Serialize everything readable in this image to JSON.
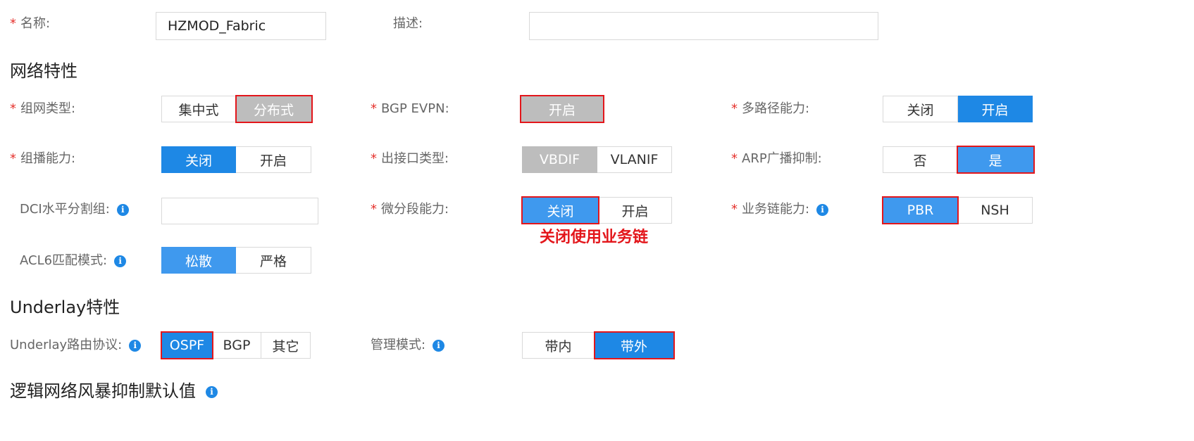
{
  "basic": {
    "required_mark": "*",
    "name_label": "名称:",
    "name_value": "HZMOD_Fabric",
    "desc_label": "描述:",
    "desc_value": ""
  },
  "network_section": {
    "title": "网络特性",
    "networking_type": {
      "label": "组网类型:",
      "options": [
        "集中式",
        "分布式"
      ],
      "selected": "分布式"
    },
    "bgp_evpn": {
      "label": "BGP EVPN:",
      "option": "开启"
    },
    "multipath": {
      "label": "多路径能力:",
      "options": [
        "关闭",
        "开启"
      ],
      "selected": "开启"
    },
    "multicast": {
      "label": "组播能力:",
      "options": [
        "关闭",
        "开启"
      ],
      "selected": "关闭"
    },
    "egress_type": {
      "label": "出接口类型:",
      "options": [
        "VBDIF",
        "VLANIF"
      ],
      "selected": "VBDIF"
    },
    "arp_suppress": {
      "label": "ARP广播抑制:",
      "options": [
        "否",
        "是"
      ],
      "selected": "是"
    },
    "dci_split": {
      "label": "DCI水平分割组:",
      "value": ""
    },
    "micro_seg": {
      "label": "微分段能力:",
      "options": [
        "关闭",
        "开启"
      ],
      "selected": "关闭",
      "note": "关闭使用业务链"
    },
    "service_chain": {
      "label": "业务链能力:",
      "options": [
        "PBR",
        "NSH"
      ],
      "selected": "PBR"
    },
    "acl6_mode": {
      "label": "ACL6匹配模式:",
      "options": [
        "松散",
        "严格"
      ],
      "selected": "松散"
    }
  },
  "underlay_section": {
    "title": "Underlay特性",
    "routing_protocol": {
      "label": "Underlay路由协议:",
      "options": [
        "OSPF",
        "BGP",
        "其它"
      ],
      "selected": "OSPF"
    },
    "mgmt_mode": {
      "label": "管理模式:",
      "options": [
        "带内",
        "带外"
      ],
      "selected": "带外"
    }
  },
  "storm_section": {
    "title": "逻辑网络风暴抑制默认值"
  },
  "icons": {
    "info": "info-icon",
    "required": "required-asterisk"
  },
  "colors": {
    "selected_blue": "#1e88e5",
    "light_blue": "#3f99ee",
    "disabled_gray": "#bdbdbd",
    "highlight_red": "#e3161b",
    "required_red": "#e5322d"
  }
}
